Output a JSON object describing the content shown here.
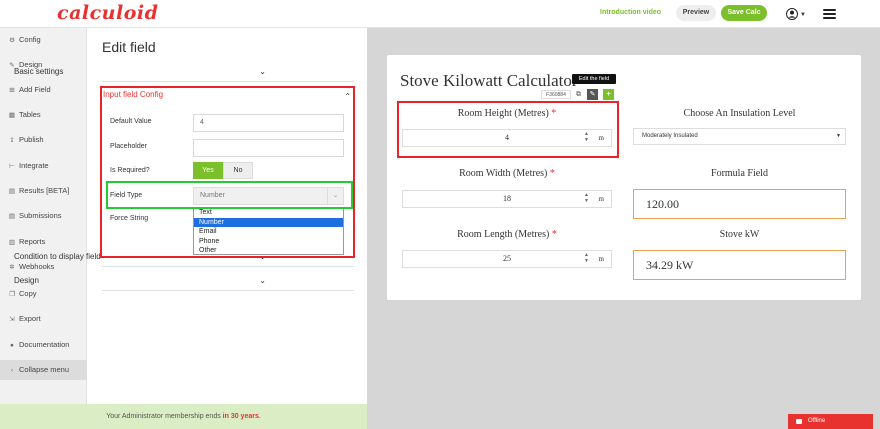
{
  "header": {
    "logo": "calculoid",
    "intro_video": "Introduction video",
    "preview": "Preview",
    "save_calc": "Save Calc"
  },
  "sidebar": {
    "items": [
      {
        "label": "Config",
        "icon": "gear-icon"
      },
      {
        "label": "Design",
        "icon": "brush-icon"
      },
      {
        "label": "Add Field",
        "icon": "plus-square-icon"
      },
      {
        "label": "Tables",
        "icon": "table-icon"
      },
      {
        "label": "Publish",
        "icon": "upload-icon"
      },
      {
        "label": "Integrate",
        "icon": "link-icon"
      },
      {
        "label": "Results [BETA]",
        "icon": "chart-icon"
      },
      {
        "label": "Submissions",
        "icon": "list-icon"
      },
      {
        "label": "Reports",
        "icon": "bar-chart-icon"
      },
      {
        "label": "Webhooks",
        "icon": "webhook-icon"
      },
      {
        "label": "Copy",
        "icon": "copy-icon"
      },
      {
        "label": "Export",
        "icon": "export-icon"
      },
      {
        "label": "Documentation",
        "icon": "info-icon"
      },
      {
        "label": "Collapse menu",
        "icon": "chevron-left-icon"
      }
    ]
  },
  "membership": {
    "prefix": "Your Administrator membership ends ",
    "highlight": "in 30 years",
    "suffix": "."
  },
  "editor": {
    "title": "Edit field",
    "basic_settings": "Basic settings",
    "input_field_config": "Input field Config",
    "default_value_label": "Default Value",
    "default_value": "4",
    "placeholder_label": "Placeholder",
    "placeholder_value": "",
    "is_required_label": "Is Required?",
    "yes": "Yes",
    "no": "No",
    "field_type_label": "Field Type",
    "field_type_value": "Number",
    "force_string_label": "Force String",
    "field_type_options": [
      "Text",
      "Number",
      "Email",
      "Phone",
      "Other"
    ],
    "condition_label": "Condition to display field",
    "design_label": "Design"
  },
  "calculator": {
    "title": "Stove Kilowatt Calculator",
    "tooltip": "Edit the field",
    "field_id": "F360884",
    "room_height_label": "Room Height (Metres)",
    "room_height_value": "4",
    "room_width_label": "Room Width (Metres)",
    "room_width_value": "18",
    "room_length_label": "Room Length (Metres)",
    "room_length_value": "25",
    "required_mark": "*",
    "unit": "m",
    "insulation_label": "Choose An Insulation Level",
    "insulation_value": "Moderately Insulated",
    "formula_label": "Formula Field",
    "formula_value": "120.00",
    "stove_label": "Stove kW",
    "stove_value": "34.29 kW"
  },
  "status": {
    "offline": "Offline"
  },
  "colors": {
    "brand_red": "#e8322f",
    "accent_green": "#7bbf2a",
    "highlight_red": "#e8242a",
    "highlight_green": "#22cc33",
    "result_border": "#f0a050"
  }
}
